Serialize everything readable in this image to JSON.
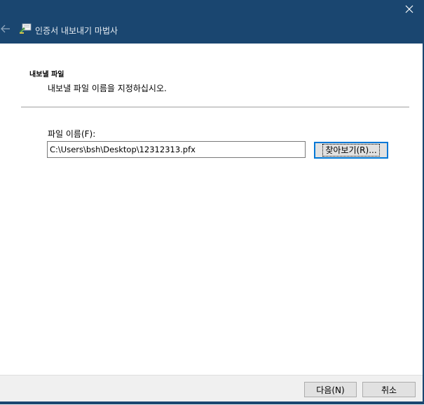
{
  "window": {
    "title": "인증서 내보내기 마법사",
    "icons": {
      "close": "close-icon",
      "back": "back-arrow-icon",
      "wizard": "certificate-icon"
    },
    "colors": {
      "titlebar": "#1a4670",
      "button_focus": "#0078d7",
      "footer": "#f0f0f0"
    }
  },
  "section": {
    "title": "내보낼 파일",
    "description": "내보낼 파일 이름을 지정하십시오."
  },
  "file": {
    "label": "파일 이름(F):",
    "value": "C:\\Users\\bsh\\Desktop\\12312313.pfx",
    "browse_label": "찾아보기(R)..."
  },
  "footer": {
    "next_label": "다음(N)",
    "cancel_label": "취소"
  }
}
